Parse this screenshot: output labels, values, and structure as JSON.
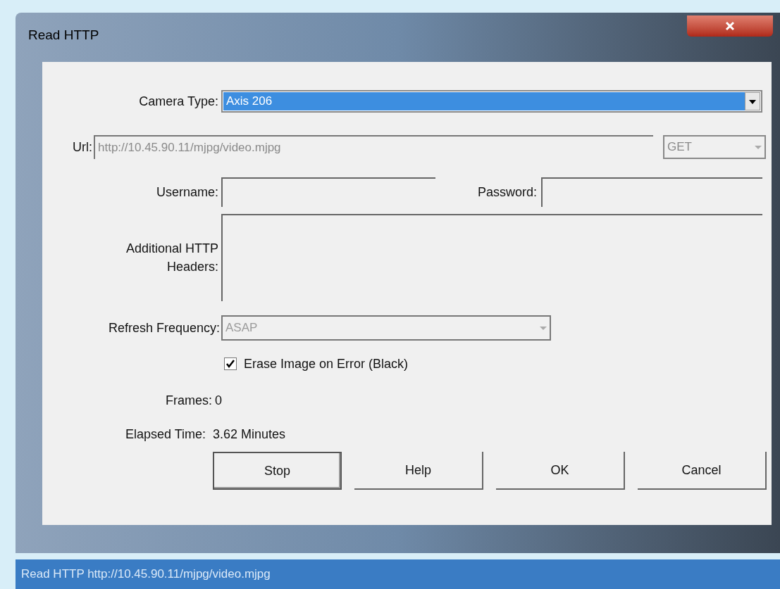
{
  "window": {
    "title": "Read HTTP"
  },
  "camera_type": {
    "label": "Camera Type:",
    "value": "Axis 206"
  },
  "url": {
    "label": "Url:",
    "value": "http://10.45.90.11/mjpg/video.mjpg",
    "disabled": true
  },
  "method": {
    "value": "GET",
    "disabled": true
  },
  "username": {
    "label": "Username:"
  },
  "password": {
    "label": "Password:"
  },
  "headers": {
    "label": "Additional HTTP Headers:"
  },
  "refresh": {
    "label": "Refresh Frequency:",
    "value": "ASAP",
    "disabled": true
  },
  "erase_on_error": {
    "label": "Erase Image on Error (Black)",
    "checked": true
  },
  "frames": {
    "label": "Frames:",
    "value": "0"
  },
  "elapsed": {
    "label": "Elapsed Time:",
    "value": "3.62 Minutes"
  },
  "buttons": [
    {
      "label": "Stop",
      "default": true
    },
    {
      "label": "Help",
      "default": false
    },
    {
      "label": "OK",
      "default": false
    },
    {
      "label": "Cancel",
      "default": false
    }
  ],
  "status_bar": {
    "text": "Read HTTP http://10.45.90.11/mjpg/video.mjpg"
  }
}
